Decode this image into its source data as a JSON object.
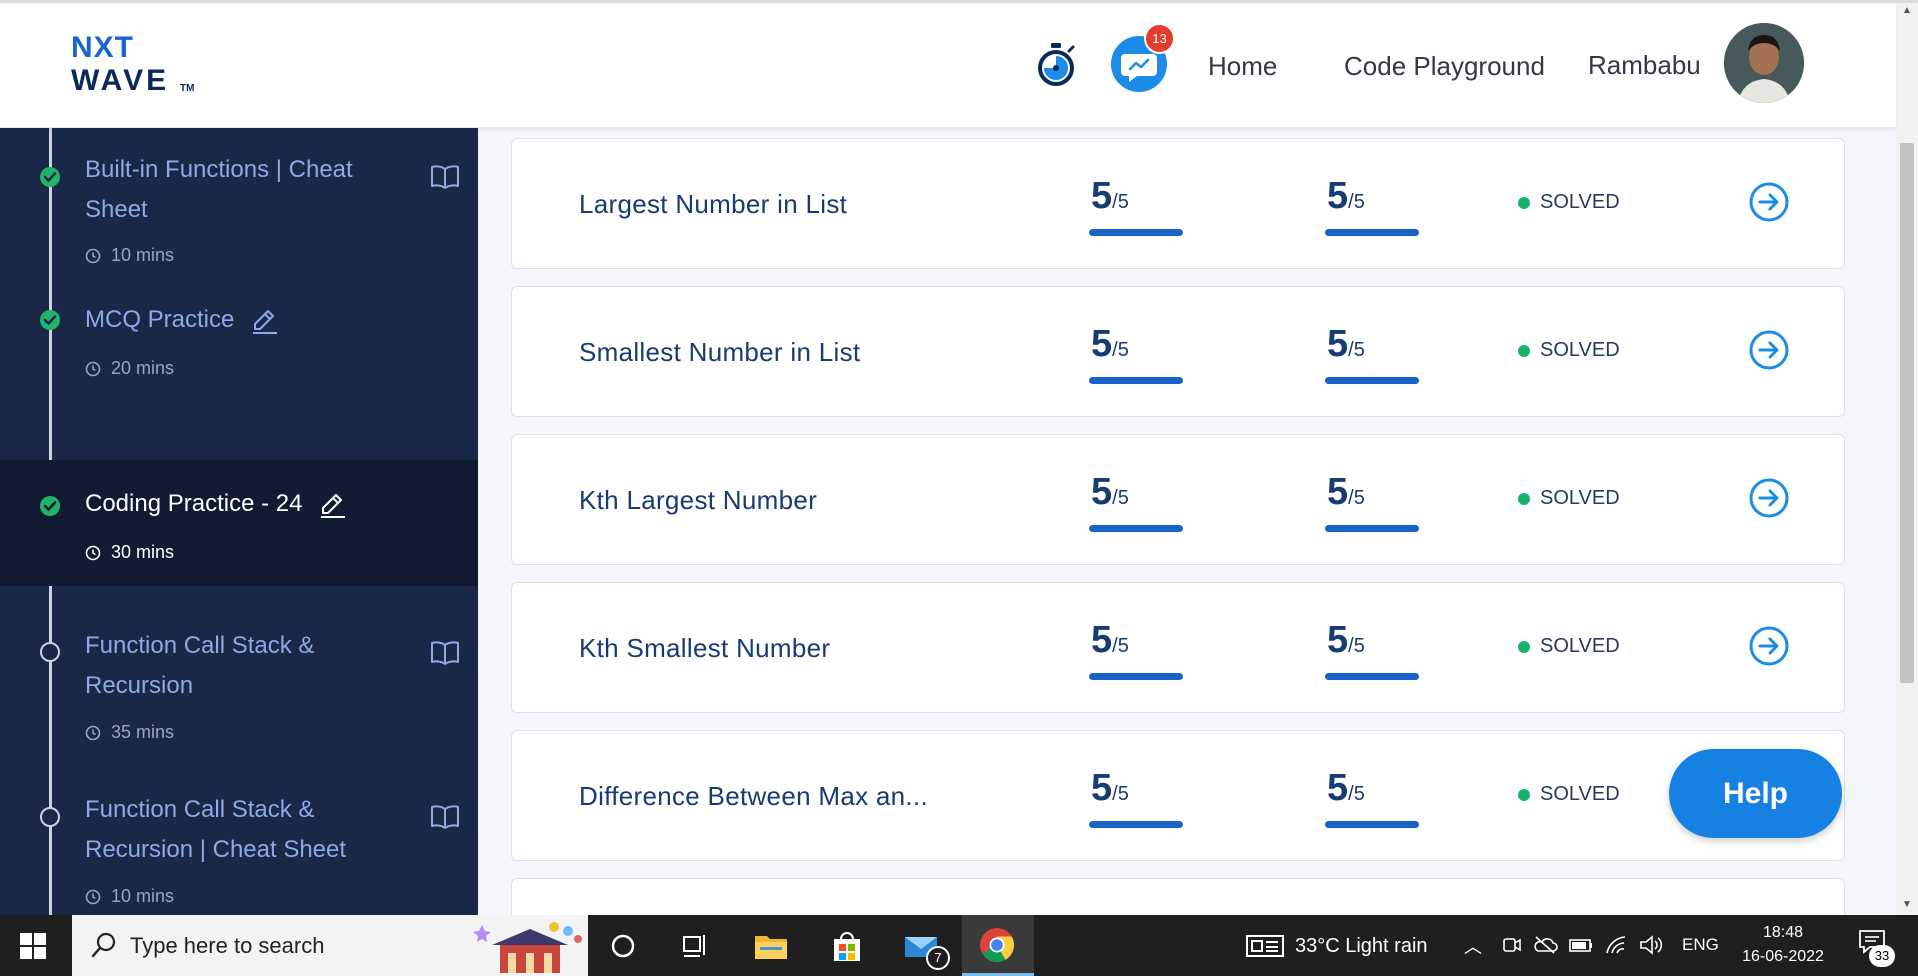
{
  "header": {
    "logo_line1": "NXT",
    "logo_line2": "WAVE",
    "logo_tm": "TM",
    "notification_count": "13",
    "nav_home": "Home",
    "nav_code_playground": "Code Playground",
    "user_name": "Rambabu"
  },
  "sidebar": {
    "items": [
      {
        "title_line1": "Built-in Functions | Cheat",
        "title_line2": "Sheet",
        "duration": "10 mins",
        "status": "completed",
        "icon": "book-icon"
      },
      {
        "title_line1": "MCQ Practice",
        "title_line2": "",
        "duration": "20 mins",
        "status": "completed",
        "icon": "pencil-icon"
      },
      {
        "title_line1": "Coding Practice - 24",
        "title_line2": "",
        "duration": "30 mins",
        "status": "completed",
        "icon": "pencil-icon",
        "active": true
      },
      {
        "title_line1": "Function Call Stack &",
        "title_line2": "Recursion",
        "duration": "35 mins",
        "status": "not-started",
        "icon": "book-icon"
      },
      {
        "title_line1": "Function Call Stack &",
        "title_line2": "Recursion | Cheat Sheet",
        "duration": "10 mins",
        "status": "not-started",
        "icon": "book-icon"
      }
    ]
  },
  "questions": [
    {
      "title": "Largest Number in List",
      "score1": "5",
      "max1": "/5",
      "score2": "5",
      "max2": "/5",
      "status": "SOLVED",
      "progress1": 1.0,
      "progress2": 1.0
    },
    {
      "title": "Smallest Number in List",
      "score1": "5",
      "max1": "/5",
      "score2": "5",
      "max2": "/5",
      "status": "SOLVED",
      "progress1": 1.0,
      "progress2": 1.0
    },
    {
      "title": "Kth Largest Number",
      "score1": "5",
      "max1": "/5",
      "score2": "5",
      "max2": "/5",
      "status": "SOLVED",
      "progress1": 1.0,
      "progress2": 1.0
    },
    {
      "title": "Kth Smallest Number",
      "score1": "5",
      "max1": "/5",
      "score2": "5",
      "max2": "/5",
      "status": "SOLVED",
      "progress1": 1.0,
      "progress2": 1.0
    },
    {
      "title": "Difference Between Max an...",
      "score1": "5",
      "max1": "/5",
      "score2": "5",
      "max2": "/5",
      "status": "SOLVED",
      "progress1": 1.0,
      "progress2": 1.0
    }
  ],
  "help_label": "Help",
  "colors": {
    "sidebar_bg": "#1a2847",
    "sidebar_active_bg": "#111b31",
    "accent_blue": "#1863c9",
    "solved_green": "#18b36a",
    "completed_green": "#22b26a",
    "help_blue": "#1681e2"
  },
  "taskbar": {
    "search_placeholder": "Type here to search",
    "mail_badge": "7",
    "weather": "33°C  Light rain",
    "language": "ENG",
    "time": "18:48",
    "date": "16-06-2022",
    "notification_count": "33"
  }
}
